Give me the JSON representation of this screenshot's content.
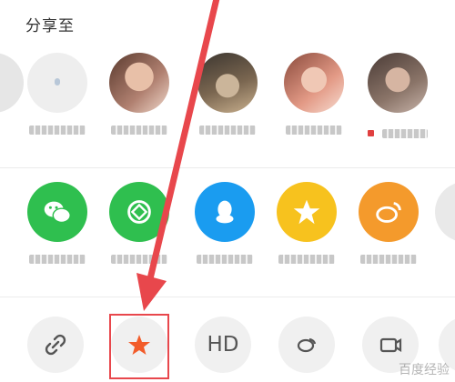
{
  "header": {
    "title": "分享至"
  },
  "contacts": [
    {
      "name": "contact-faded-edge"
    },
    {
      "name": "contact-plain",
      "label": ""
    },
    {
      "name": "contact-1",
      "label": ""
    },
    {
      "name": "contact-2",
      "label": ""
    },
    {
      "name": "contact-3",
      "label": ""
    },
    {
      "name": "contact-4",
      "label": ""
    }
  ],
  "apps": [
    {
      "name": "wechat",
      "color": "#2fbf4f",
      "label": ""
    },
    {
      "name": "moments",
      "color": "#2fbf4f",
      "label": ""
    },
    {
      "name": "qq",
      "color": "#1a9cf0",
      "label": ""
    },
    {
      "name": "qzone",
      "color": "#f7c21e",
      "label": ""
    },
    {
      "name": "weibo",
      "color": "#f49a2c",
      "label": ""
    }
  ],
  "tools": {
    "link_icon": "link-icon",
    "favorite_icon": "star-icon",
    "favorite_color": "#f25c2a",
    "hd_label": "HD",
    "audio_icon": "audio-icon",
    "video_icon": "video-icon"
  },
  "annotation": {
    "arrow_color": "#e8474c"
  },
  "watermark": "百度经验"
}
